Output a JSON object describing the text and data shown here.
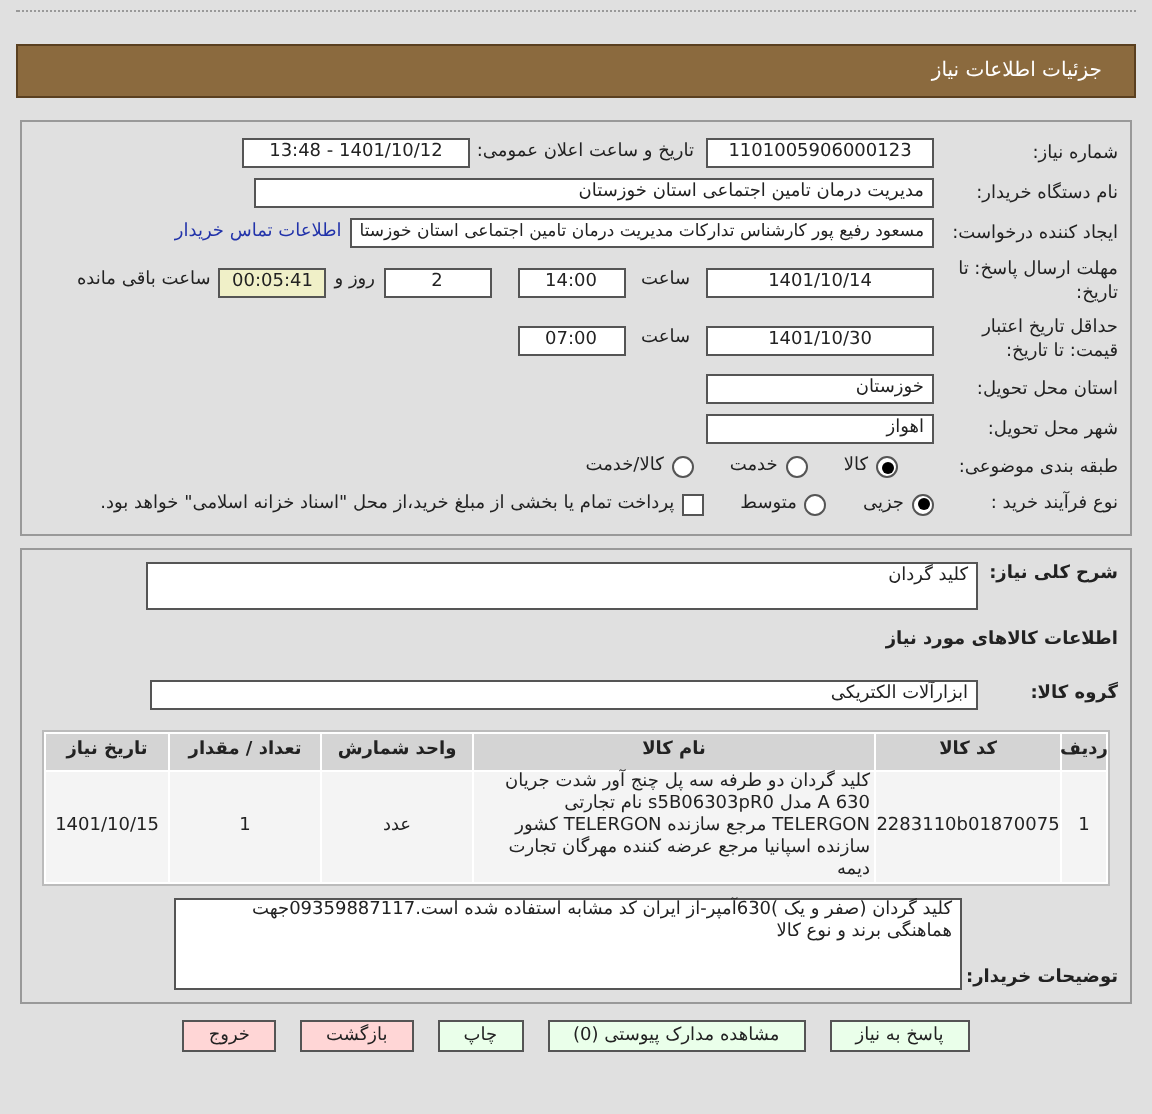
{
  "header": {
    "title": "جزئیات اطلاعات نیاز"
  },
  "need_number": {
    "label": "شماره نیاز:",
    "value": "1101005906000123"
  },
  "announce": {
    "label": "تاریخ و ساعت اعلان عمومی:",
    "value": "1401/10/12 - 13:48"
  },
  "buyer": {
    "label": "نام دستگاه خریدار:",
    "value": "مدیریت درمان تامین اجتماعی استان خوزستان"
  },
  "creator": {
    "label": "ایجاد کننده درخواست:",
    "value": "مسعود رفیع پور کارشناس تدارکات مدیریت درمان تامین اجتماعی استان خوزستا",
    "link": "اطلاعات تماس خریدار"
  },
  "deadline": {
    "label": "مهلت ارسال پاسخ: تا تاریخ:",
    "date": "1401/10/14",
    "time_label": "ساعت",
    "time": "14:00",
    "days": "2",
    "days_label": "روز و",
    "remaining": "00:05:41",
    "remaining_label": "ساعت باقی مانده"
  },
  "validity": {
    "label": "حداقل تاریخ اعتبار قیمت: تا تاریخ:",
    "date": "1401/10/30",
    "time_label": "ساعت",
    "time": "07:00"
  },
  "province": {
    "label": "استان محل تحویل:",
    "value": "خوزستان"
  },
  "city": {
    "label": "شهر محل تحویل:",
    "value": "اهواز"
  },
  "category": {
    "label": "طبقه بندی موضوعی:",
    "options": [
      {
        "label": "کالا",
        "selected": true
      },
      {
        "label": "خدمت",
        "selected": false
      },
      {
        "label": "کالا/خدمت",
        "selected": false
      }
    ]
  },
  "purchase": {
    "label": "نوع فرآیند خرید :",
    "options": [
      {
        "label": "جزیی",
        "selected": true
      },
      {
        "label": "متوسط",
        "selected": false
      }
    ],
    "payment": {
      "label": "پرداخت تمام یا بخشی از مبلغ خرید،از محل \"اسناد خزانه اسلامی\" خواهد بود.",
      "checked": false
    }
  },
  "description": {
    "label": "شرح کلی نیاز:",
    "value": "کلید گردان"
  },
  "goods_title": "اطلاعات کالاهای مورد نیاز",
  "group": {
    "label": "گروه کالا:",
    "value": "ابزارآلات الکتریکی"
  },
  "table": {
    "columns": [
      "ردیف",
      "کد کالا",
      "نام کالا",
      "واحد شمارش",
      "تعداد / مقدار",
      "تاریخ نیاز"
    ],
    "rows": [
      [
        "1",
        "2283110b01870075",
        "کلید گردان دو طرفه سه پل چنج آور شدت جریان 630 A مدل s5B06303pR0 نام تجارتی TELERGON مرجع سازنده TELERGON کشور سازنده اسپانیا مرجع عرضه کننده مهرگان تجارت دیمه",
        "عدد",
        "1",
        "1401/10/15"
      ]
    ]
  },
  "notes": {
    "label": "توضیحات خریدار:",
    "value": "کلید گردان (صفر و یک )630آمپر-از ایران کد مشابه استفاده شده است.09359887117جهت هماهنگی برند و نوع کالا"
  },
  "buttons": [
    {
      "label": "پاسخ به نیاز",
      "kind": "primary"
    },
    {
      "label": "مشاهده مدارک پیوستی (0)",
      "kind": "primary"
    },
    {
      "label": "چاپ",
      "kind": "primary"
    },
    {
      "label": "بازگشت",
      "kind": "danger"
    },
    {
      "label": "خروج",
      "kind": "danger"
    }
  ]
}
